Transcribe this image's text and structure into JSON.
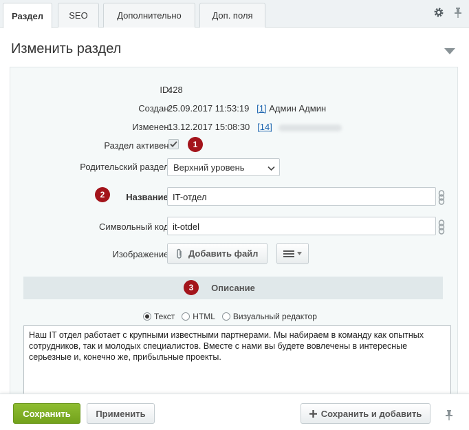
{
  "tabs": [
    {
      "label": "Раздел",
      "active": true
    },
    {
      "label": "SEO",
      "active": false
    },
    {
      "label": "Дополнительно",
      "active": false
    },
    {
      "label": "Доп. поля",
      "active": false
    }
  ],
  "header": {
    "title": "Изменить раздел"
  },
  "fields": {
    "id": {
      "label": "ID:",
      "value": "428"
    },
    "created": {
      "label": "Создан:",
      "date": "25.09.2017 11:53:19",
      "user_link": "[1]",
      "user_name": "Админ Админ"
    },
    "modified": {
      "label": "Изменен:",
      "date": "13.12.2017 15:08:30",
      "user_link": "[14]"
    },
    "active": {
      "label": "Раздел активен:",
      "checked": true
    },
    "parent": {
      "label": "Родительский раздел:",
      "value": "Верхний уровень"
    },
    "name": {
      "label": "Название:",
      "value": "IT-отдел"
    },
    "code": {
      "label": "Символьный код:",
      "value": "it-otdel"
    },
    "image": {
      "label": "Изображение:",
      "add_button": "Добавить файл"
    }
  },
  "badges": [
    "1",
    "2",
    "3"
  ],
  "description": {
    "section_title": "Описание",
    "modes": [
      {
        "label": "Текст",
        "selected": true
      },
      {
        "label": "HTML",
        "selected": false
      },
      {
        "label": "Визуальный редактор",
        "selected": false
      }
    ],
    "text": "Наш IT отдел работает с крупными известными партнерами. Мы набираем в команду как опытных сотрудников, так и молодых специалистов. Вместе с нами вы будете вовлечены в интересные серьезные и, конечно же, прибыльные проекты."
  },
  "footer": {
    "save": "Сохранить",
    "apply": "Применить",
    "save_add": "Сохранить и добавить"
  },
  "colors": {
    "badge": "#a3141b",
    "save_button": "#7fae25",
    "link": "#2067b0"
  }
}
